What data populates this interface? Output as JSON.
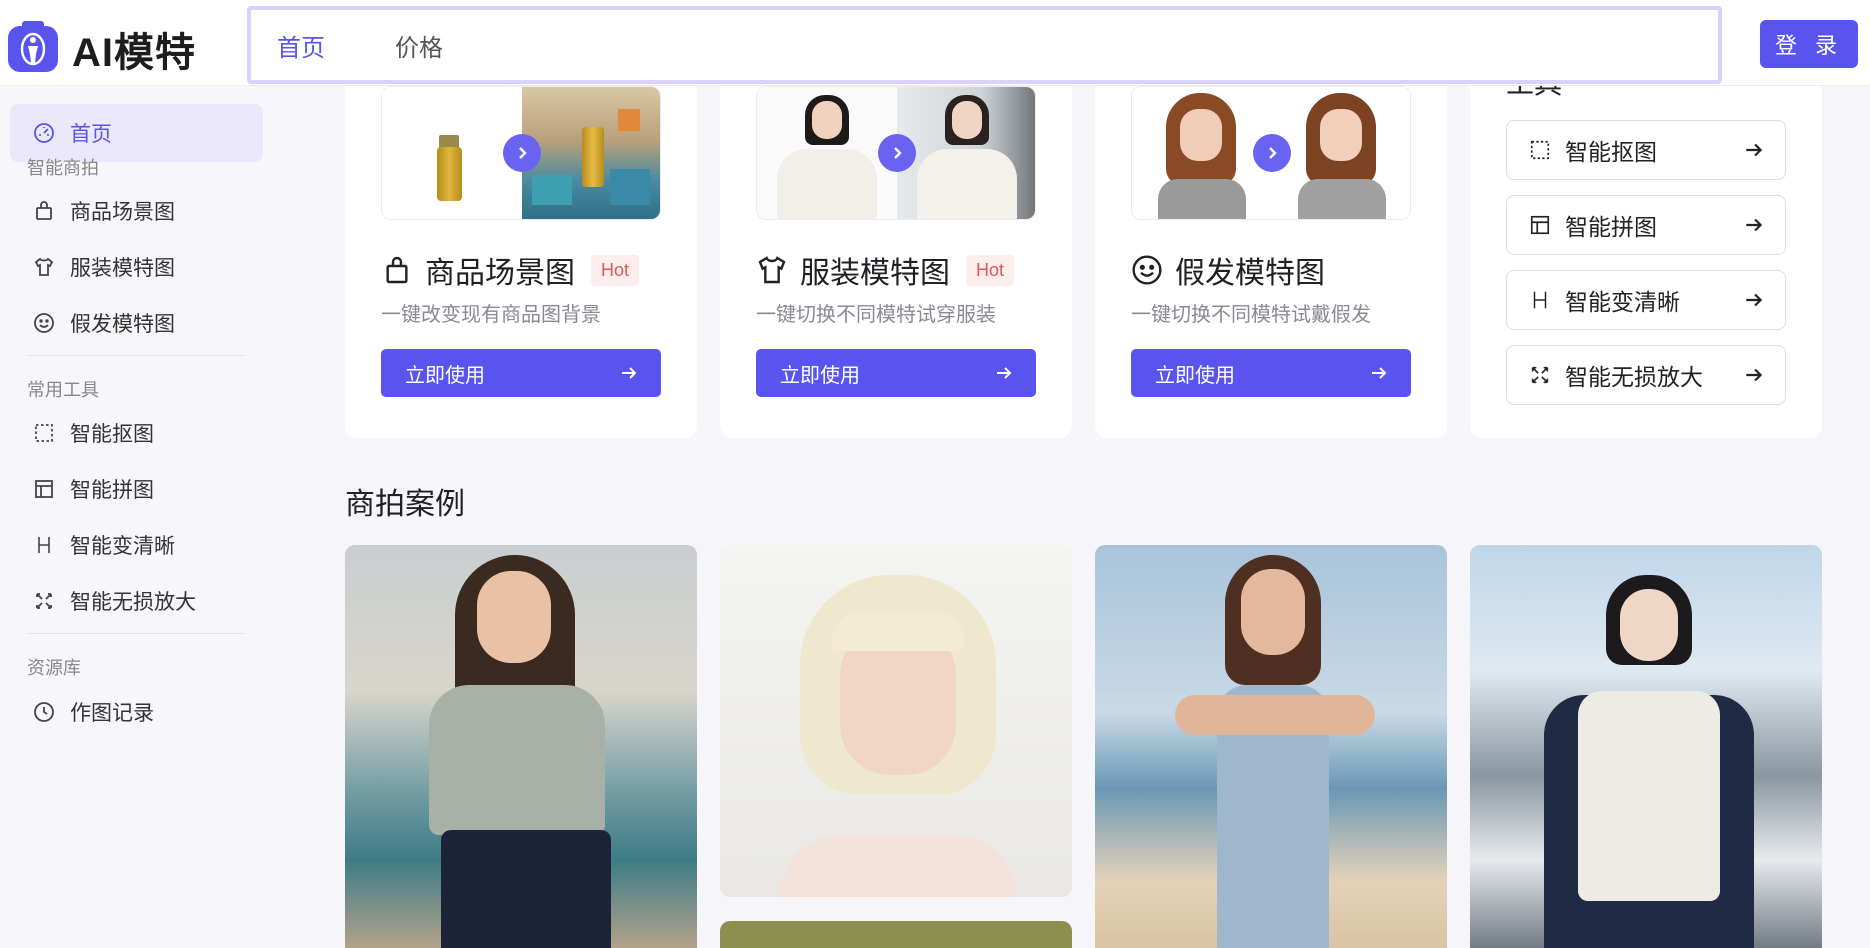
{
  "header": {
    "app_name": "AI模特",
    "nav": [
      "首页",
      "价格"
    ],
    "login_label": "登 录"
  },
  "sidebar": {
    "home_label": "首页",
    "sections": [
      {
        "title": "智能商拍",
        "items": [
          "商品场景图",
          "服装模特图",
          "假发模特图"
        ]
      },
      {
        "title": "常用工具",
        "items": [
          "智能抠图",
          "智能拼图",
          "智能变清晰",
          "智能无损放大"
        ]
      },
      {
        "title": "资源库",
        "items": [
          "作图记录"
        ]
      }
    ]
  },
  "feature_cards": [
    {
      "title": "商品场景图",
      "badge": "Hot",
      "desc": "一键改变现有商品图背景",
      "button": "立即使用",
      "icon": "shopping-bag-icon"
    },
    {
      "title": "服装模特图",
      "badge": "Hot",
      "desc": "一键切换不同模特试穿服装",
      "button": "立即使用",
      "icon": "shirt-icon"
    },
    {
      "title": "假发模特图",
      "badge": "",
      "desc": "一键切换不同模特试戴假发",
      "button": "立即使用",
      "icon": "smile-icon"
    }
  ],
  "tools_card": {
    "heading": "工具",
    "items": [
      "智能抠图",
      "智能拼图",
      "智能变清晰",
      "智能无损放大"
    ]
  },
  "cases": {
    "title": "商拍案例"
  },
  "colors": {
    "accent": "#5a54ee",
    "hot": "#e25757",
    "background": "#f6f6fa"
  }
}
